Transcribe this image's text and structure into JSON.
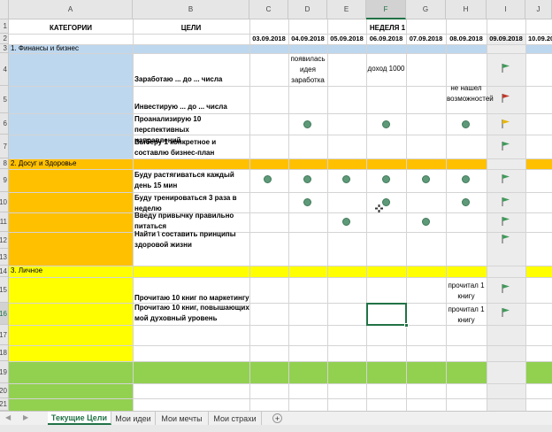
{
  "columns": [
    "A",
    "B",
    "C",
    "D",
    "E",
    "F",
    "G",
    "H",
    "I",
    "J"
  ],
  "rows": [
    "1",
    "2",
    "3",
    "4",
    "5",
    "6",
    "7",
    "8",
    "9",
    "10",
    "11",
    "12",
    "13",
    "14",
    "15",
    "16",
    "17",
    "18",
    "19",
    "20",
    "21"
  ],
  "header": {
    "categories": "КАТЕГОРИИ",
    "goals": "ЦЕЛИ",
    "week": "НЕДЕЛЯ 1",
    "dates": [
      "03.09.2018",
      "04.09.2018",
      "05.09.2018",
      "06.09.2018",
      "07.09.2018",
      "08.09.2018",
      "09.09.2018",
      "10.09.20"
    ]
  },
  "categories": [
    {
      "label": "1. Финансы и бизнес",
      "color": "#bdd7ee"
    },
    {
      "label": "2. Досуг и Здоровье",
      "color": "#ffc000"
    },
    {
      "label": "3. Личное",
      "color": "#ffff00"
    },
    {
      "label": "",
      "color": "#92d050"
    }
  ],
  "goals": [
    "Заработаю ... до ... числа",
    "Инвестирую ... до ... числа",
    "Проанализирую 10 перспективных направлений",
    "Выберу 1 конкретное и составлю бизнес-план",
    "Буду растягиваться каждый день 15 мин",
    "Буду тренироваться 3 раза в неделю",
    "Введу привычку правильно питаться",
    "Найти \\ составить принципы здоровой жизни",
    "Прочитаю 10 книг по маркетингу",
    "Прочитаю 10 книг, повышающих мой духовный уровень"
  ],
  "notes": {
    "idea": "появилась идея заработка",
    "income": "доход 1000",
    "notfound": "не нашел возможностей",
    "book1": "прочитал 1 книгу",
    "book2": "прочитал 1 книгу"
  },
  "flag_colors": {
    "green": "#3f9a5a",
    "red": "#c0392b",
    "yellow": "#e8b400"
  },
  "dot_color": "#5e9a79",
  "tabs": [
    "Текущие Цели",
    "Мои идеи",
    "Мои мечты",
    "Мои страхи"
  ],
  "add_sheet": "+",
  "nav": {
    "prev": "◀",
    "next": "▶"
  },
  "selected_cell": "F16"
}
